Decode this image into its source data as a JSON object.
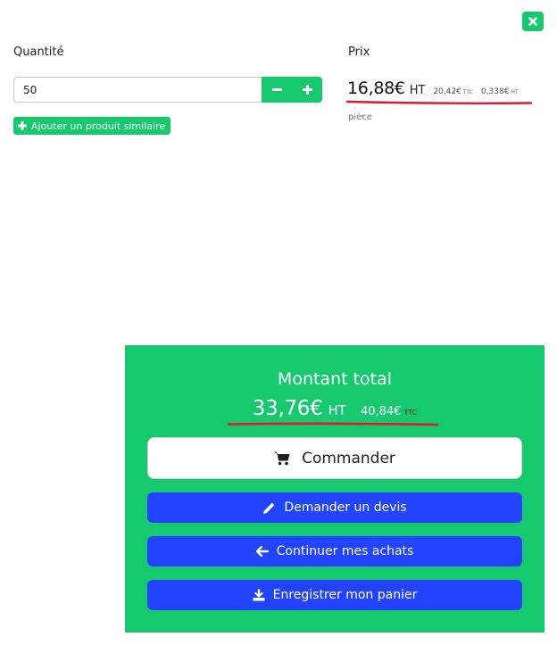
{
  "modal": {
    "close_icon": "close-icon",
    "quantity_label": "Quantité",
    "price_label": "Prix",
    "quantity_value": "50",
    "minus_icon": "minus-icon",
    "plus_icon": "plus-icon",
    "add_similar_label": "Ajouter un produit similaire",
    "price": {
      "main": "16,88€",
      "ht": "HT",
      "ttc_value": "20,42€",
      "ttc_tag": "TTC",
      "unit_value": "0,338€",
      "unit_tag": "HT",
      "per_label": "pièce"
    }
  },
  "total": {
    "title": "Montant total",
    "main": "33,76€",
    "ht": "HT",
    "ttc_value": "40,84€",
    "ttc_tag": "TTC",
    "order_label": "Commander",
    "order_icon": "cart-icon",
    "quote_label": "Demander un devis",
    "quote_icon": "pencil-icon",
    "continue_label": "Continuer mes achats",
    "continue_icon": "arrow-left-icon",
    "save_label": "Enregistrer mon panier",
    "save_icon": "download-icon"
  },
  "colors": {
    "accent_green": "#16c96f",
    "button_blue": "#2244ff",
    "underline_red": "#e0182d"
  }
}
